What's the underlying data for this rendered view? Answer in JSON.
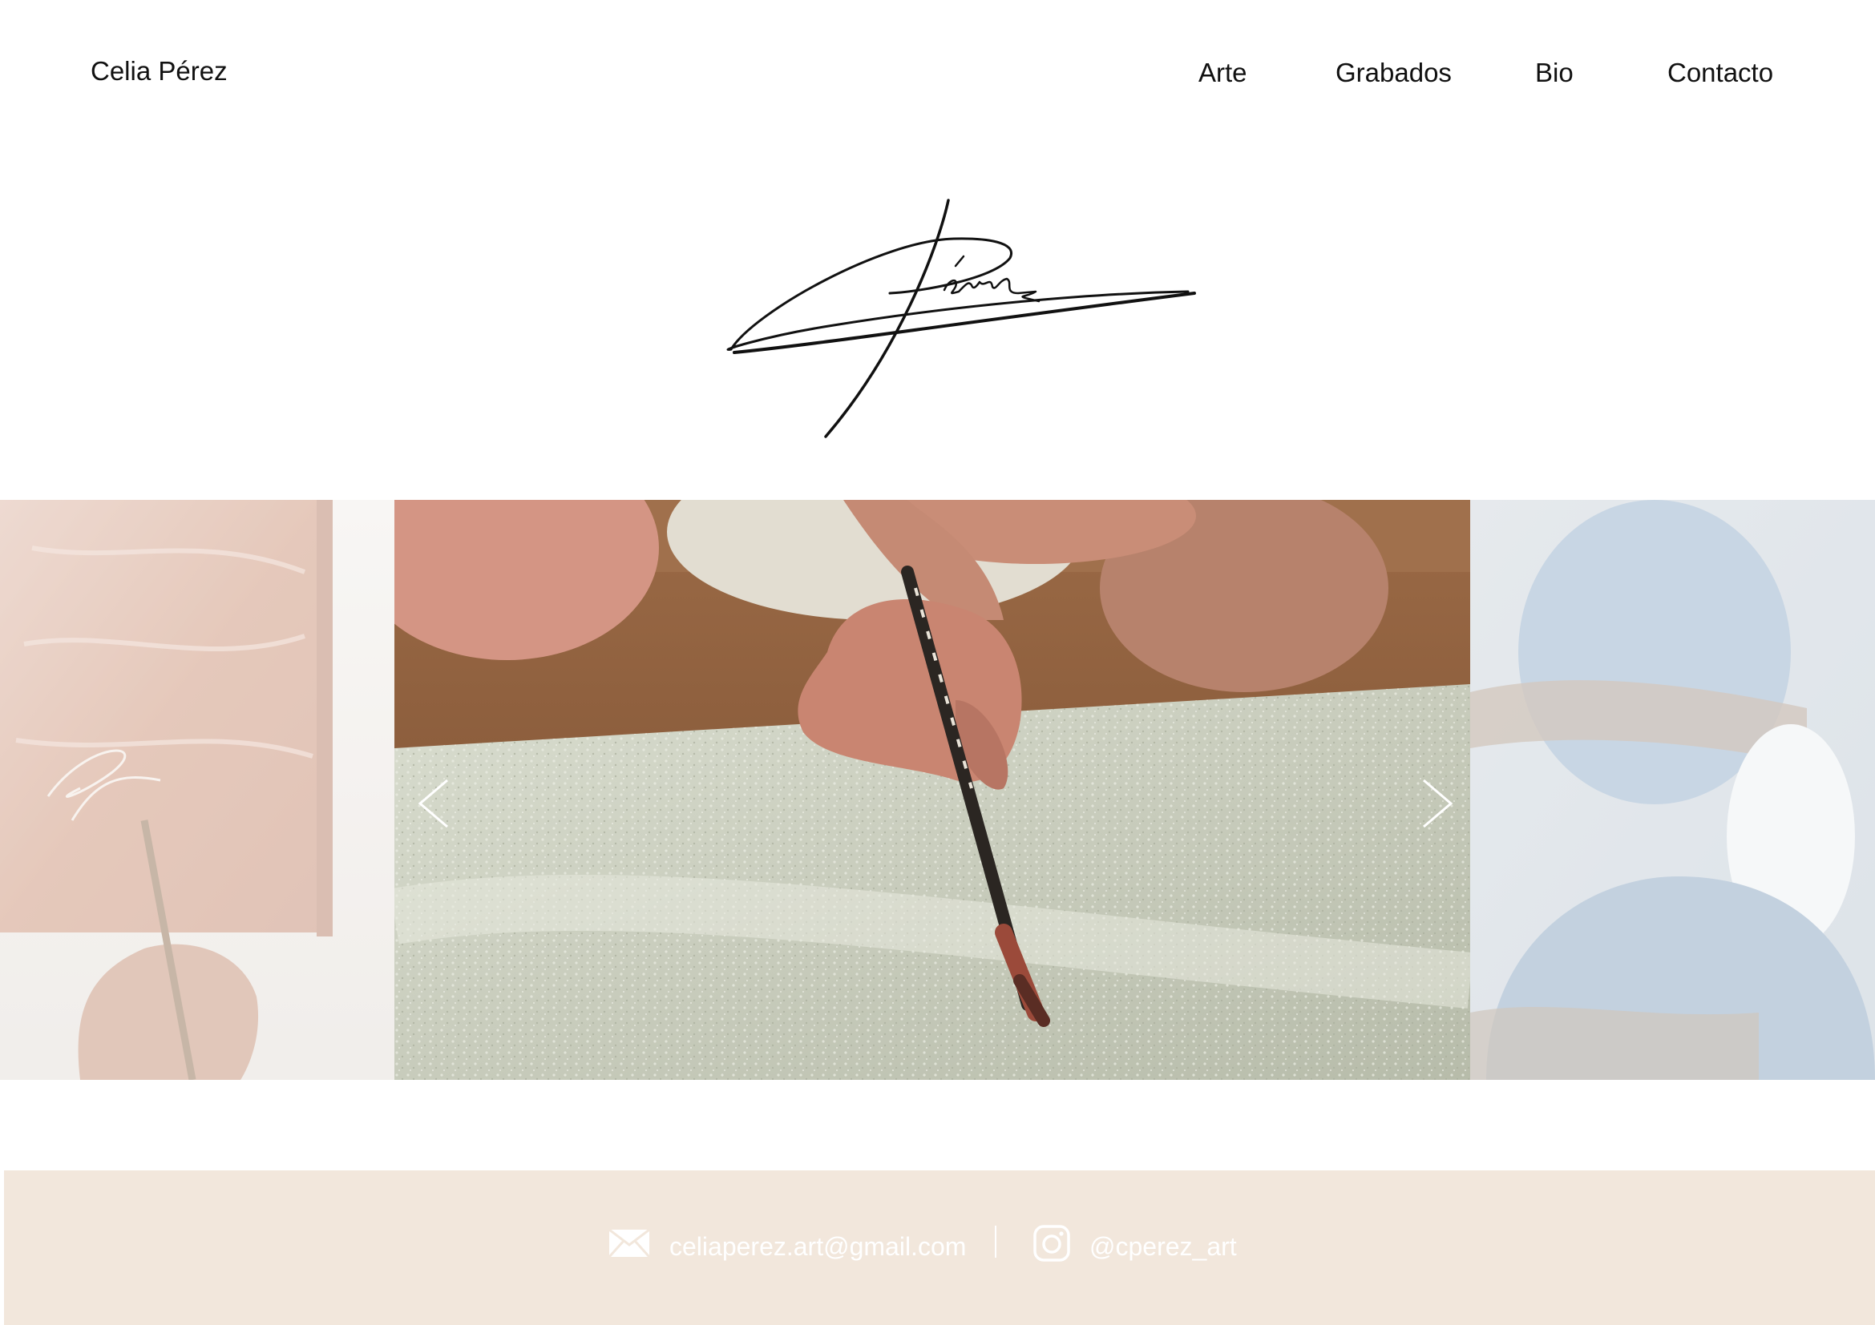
{
  "header": {
    "brand": "Celia Pérez",
    "nav": [
      {
        "label": "Arte"
      },
      {
        "label": "Grabados"
      },
      {
        "label": "Bio"
      },
      {
        "label": "Contacto"
      }
    ]
  },
  "logo": {
    "signature_text": "Pérez",
    "icon": "signature-logo"
  },
  "carousel": {
    "slides": [
      {
        "icon": "painting-pink-canvas-image",
        "active": false
      },
      {
        "icon": "hand-painting-textured-canvas-image",
        "active": true
      },
      {
        "icon": "blue-portrait-painting-image",
        "active": false
      }
    ],
    "prev_icon": "chevron-left-icon",
    "next_icon": "chevron-right-icon"
  },
  "footer": {
    "email": "celiaperez.art@gmail.com",
    "email_icon": "envelope-icon",
    "instagram": "@cperez_art",
    "instagram_icon": "instagram-icon",
    "background": "#f2e7dc",
    "text_color": "#ffffff"
  }
}
